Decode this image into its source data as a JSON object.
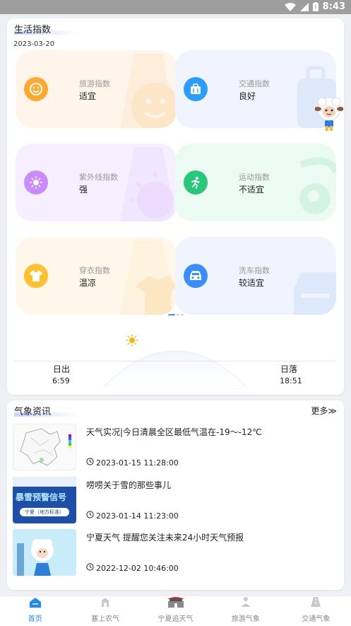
{
  "status_bar": {
    "time": "8:43"
  },
  "life_index": {
    "title": "生活指数",
    "date": "2023-03-20",
    "tiles": [
      {
        "label": "旅游指数",
        "value": "适宜",
        "icon": "smile-icon",
        "color": "#ffa82e"
      },
      {
        "label": "交通指数",
        "value": "良好",
        "icon": "luggage-icon",
        "color": "#2a9dff"
      },
      {
        "label": "紫外线指数",
        "value": "强",
        "icon": "sun-icon",
        "color": "#c98bff"
      },
      {
        "label": "运动指数",
        "value": "不适宜",
        "icon": "running-icon",
        "color": "#28c77a"
      },
      {
        "label": "穿衣指数",
        "value": "温凉",
        "icon": "shirt-icon",
        "color": "#ffc02e"
      },
      {
        "label": "洗车指数",
        "value": "较适宜",
        "icon": "car-icon",
        "color": "#3a8dff"
      }
    ],
    "sunrise_label": "日出",
    "sunrise_time": "6:59",
    "sunset_label": "日落",
    "sunset_time": "18:51"
  },
  "weather_news": {
    "title": "气象资讯",
    "more_label": "更多≫",
    "items": [
      {
        "title": "天气实况|今日清晨全区最低气温在-19～-12℃",
        "time": "2023-01-15 11:28:00",
        "thumb": "map-thumbnail"
      },
      {
        "title": "唠唠关于雪的那些事儿",
        "time": "2023-01-14 11:23:00",
        "thumb": "snow-warning-thumbnail",
        "thumb_text": "暴雪预警信号",
        "thumb_subtext": "宁夏（地方标准）"
      },
      {
        "title": "宁夏天气 提醒您关注未来24小时天气预报",
        "time": "2022-12-02 10:46:00",
        "thumb": "cartoon-thumbnail"
      }
    ]
  },
  "tabs": [
    {
      "label": "首页",
      "active": true
    },
    {
      "label": "塞上农气",
      "active": false
    },
    {
      "label": "宁夏追天气",
      "active": false
    },
    {
      "label": "旅游气象",
      "active": false
    },
    {
      "label": "交通气象",
      "active": false
    }
  ]
}
